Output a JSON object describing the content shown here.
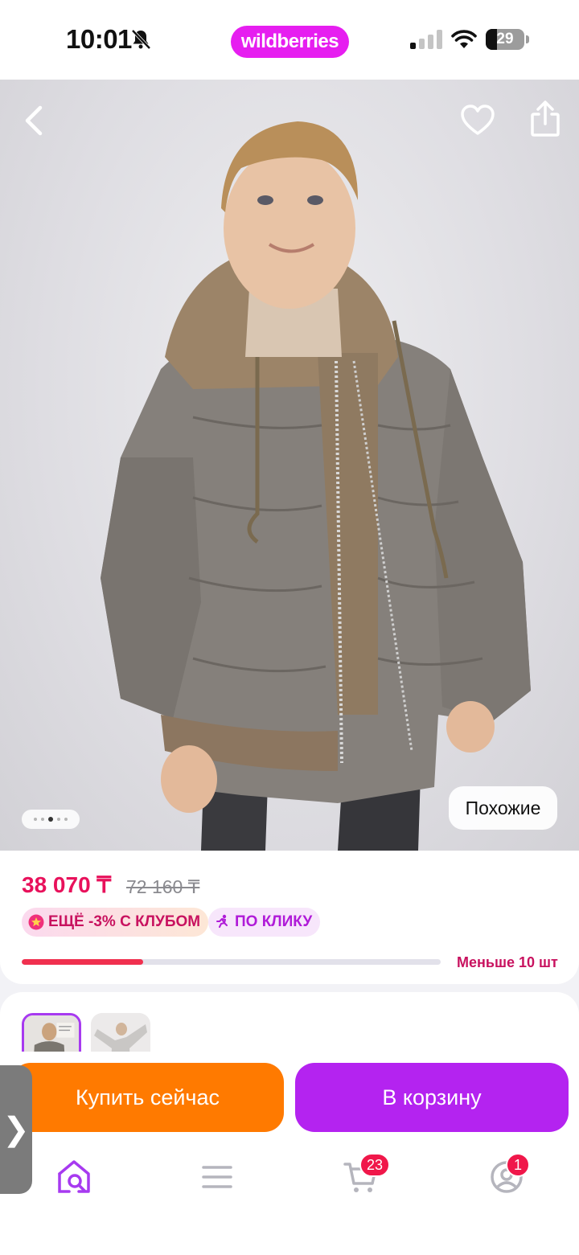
{
  "status_bar": {
    "time": "10:01",
    "brand": "wildberries",
    "battery": "29",
    "battery_level": 0.29,
    "icons": [
      "mute-icon",
      "signal-icon",
      "wifi-icon",
      "battery-icon"
    ]
  },
  "photo": {
    "similar_label": "Похожие",
    "dots_total": 5,
    "dots_active_index": 3,
    "icons": [
      "chevron-left-icon",
      "heart-icon",
      "share-icon"
    ]
  },
  "price": {
    "current": "38 070 ₸",
    "old": "72 160 ₸",
    "club_badge": "ЕЩЁ -3% С КЛУБОМ",
    "click_badge": "ПО КЛИКУ",
    "stock_label": "Меньше 10 шт",
    "stock_level": 0.29
  },
  "actions": {
    "buy_now": "Купить сейчас",
    "add_to_cart": "В корзину",
    "side_tab": "❯"
  },
  "nav": {
    "cart_count": "23",
    "profile_count": "1",
    "icons": [
      "home-search-icon",
      "menu-icon",
      "cart-icon",
      "profile-icon"
    ]
  },
  "colors": {
    "brand": "#e61ef0",
    "price": "#e8115b",
    "buy_now": "#ff7a00",
    "cart": "#b423f0",
    "badge": "#f0174a"
  }
}
